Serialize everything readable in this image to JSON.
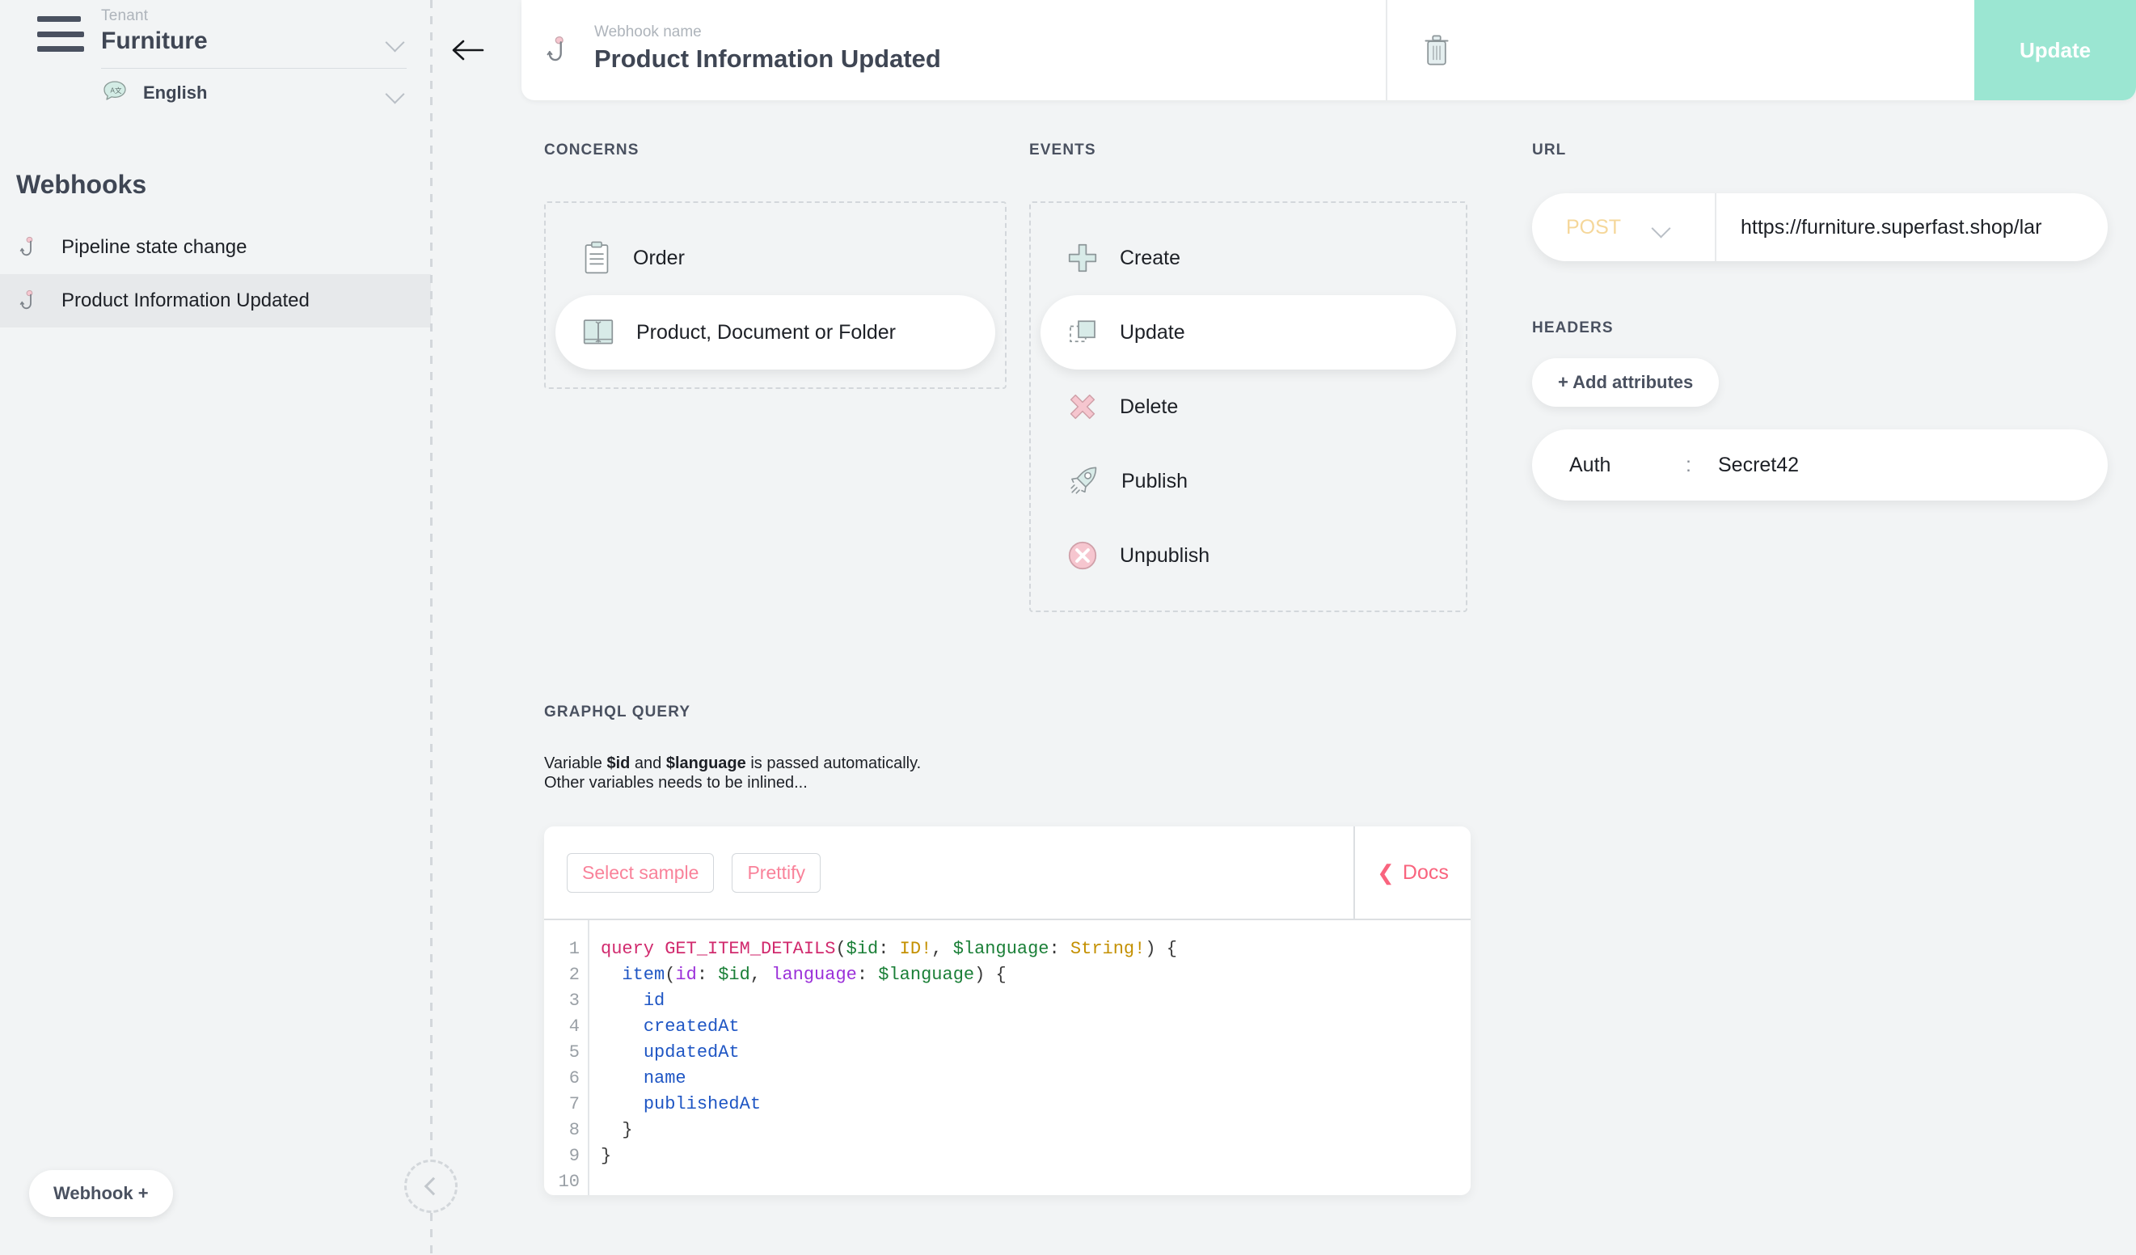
{
  "sidebar": {
    "menu_icon": "hamburger-icon",
    "tenant_label": "Tenant",
    "tenant_name": "Furniture",
    "language_icon": "translate-icon",
    "language": "English",
    "heading": "Webhooks",
    "items": [
      {
        "label": "Pipeline state change",
        "icon": "fishhook-icon",
        "active": false
      },
      {
        "label": "Product Information Updated",
        "icon": "fishhook-icon",
        "active": true
      }
    ],
    "add_button": "Webhook +",
    "collapse_icon": "chevron-left-icon"
  },
  "header": {
    "back_icon": "arrow-left-icon",
    "webhook_icon": "fishhook-icon",
    "name_label": "Webhook name",
    "name_value": "Product Information Updated",
    "delete_icon": "trash-icon",
    "update_label": "Update",
    "update_color": "#9be6d2"
  },
  "concerns": {
    "title": "CONCERNS",
    "options": [
      {
        "label": "Order",
        "icon": "clipboard-icon",
        "selected": false
      },
      {
        "label": "Product, Document or Folder",
        "icon": "open-book-icon",
        "selected": true
      }
    ]
  },
  "events": {
    "title": "EVENTS",
    "options": [
      {
        "label": "Create",
        "icon": "plus-icon",
        "selected": false
      },
      {
        "label": "Update",
        "icon": "duplicate-icon",
        "selected": true
      },
      {
        "label": "Delete",
        "icon": "cross-icon",
        "selected": false
      },
      {
        "label": "Publish",
        "icon": "rocket-icon",
        "selected": false
      },
      {
        "label": "Unpublish",
        "icon": "circle-cross-icon",
        "selected": false
      }
    ]
  },
  "url": {
    "title": "URL",
    "method": "POST",
    "method_color": "#f5d79a",
    "method_chevron_icon": "chevron-down-icon",
    "value": "https://furniture.superfast.shop/lar",
    "placeholder": "https://"
  },
  "headers": {
    "title": "HEADERS",
    "add_label": "+ Add attributes",
    "entries": [
      {
        "key": "Auth",
        "separator": ":",
        "value": "Secret42"
      }
    ]
  },
  "graphql": {
    "title": "GRAPHQL QUERY",
    "note_line1_pre": "Variable ",
    "note_var1": "$id",
    "note_line1_mid": " and ",
    "note_var2": "$language",
    "note_line1_post": " is passed automatically.",
    "note_line2": "Other variables needs to be inlined...",
    "toolbar": {
      "select_sample": "Select sample",
      "prettify": "Prettify",
      "docs": "Docs",
      "docs_icon": "chevron-left-icon"
    },
    "line_numbers": [
      "1",
      "2",
      "3",
      "4",
      "5",
      "6",
      "7",
      "8",
      "9",
      "10"
    ],
    "code_lines": [
      "query GET_ITEM_DETAILS($id: ID!, $language: String!) {",
      "  item(id: $id, language: $language) {",
      "    id",
      "    createdAt",
      "    updatedAt",
      "    name",
      "    publishedAt",
      "  }",
      "}",
      ""
    ]
  }
}
